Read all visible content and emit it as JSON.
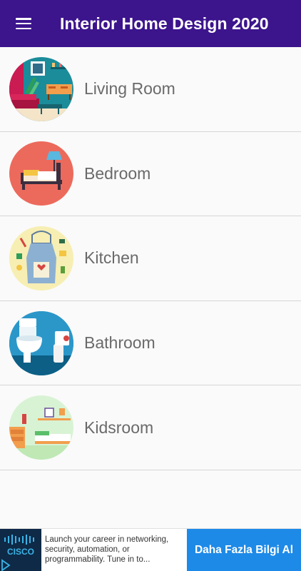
{
  "app": {
    "title": "Interior Home Design 2020"
  },
  "icons": {
    "menu": "hamburger-menu-icon"
  },
  "colors": {
    "appbar": "#3c148c",
    "ad_button": "#1d8ae8"
  },
  "rooms": [
    {
      "label": "Living Room",
      "image": "living-room-icon"
    },
    {
      "label": "Bedroom",
      "image": "bedroom-icon"
    },
    {
      "label": "Kitchen",
      "image": "kitchen-icon"
    },
    {
      "label": "Bathroom",
      "image": "bathroom-icon"
    },
    {
      "label": "Kidsroom",
      "image": "kidsroom-icon"
    }
  ],
  "ad": {
    "logo_text": "CISCO",
    "body": "Launch your career in networking, security, automation, or programmability. Tune in to...",
    "cta": "Daha Fazla Bilgi Al"
  }
}
